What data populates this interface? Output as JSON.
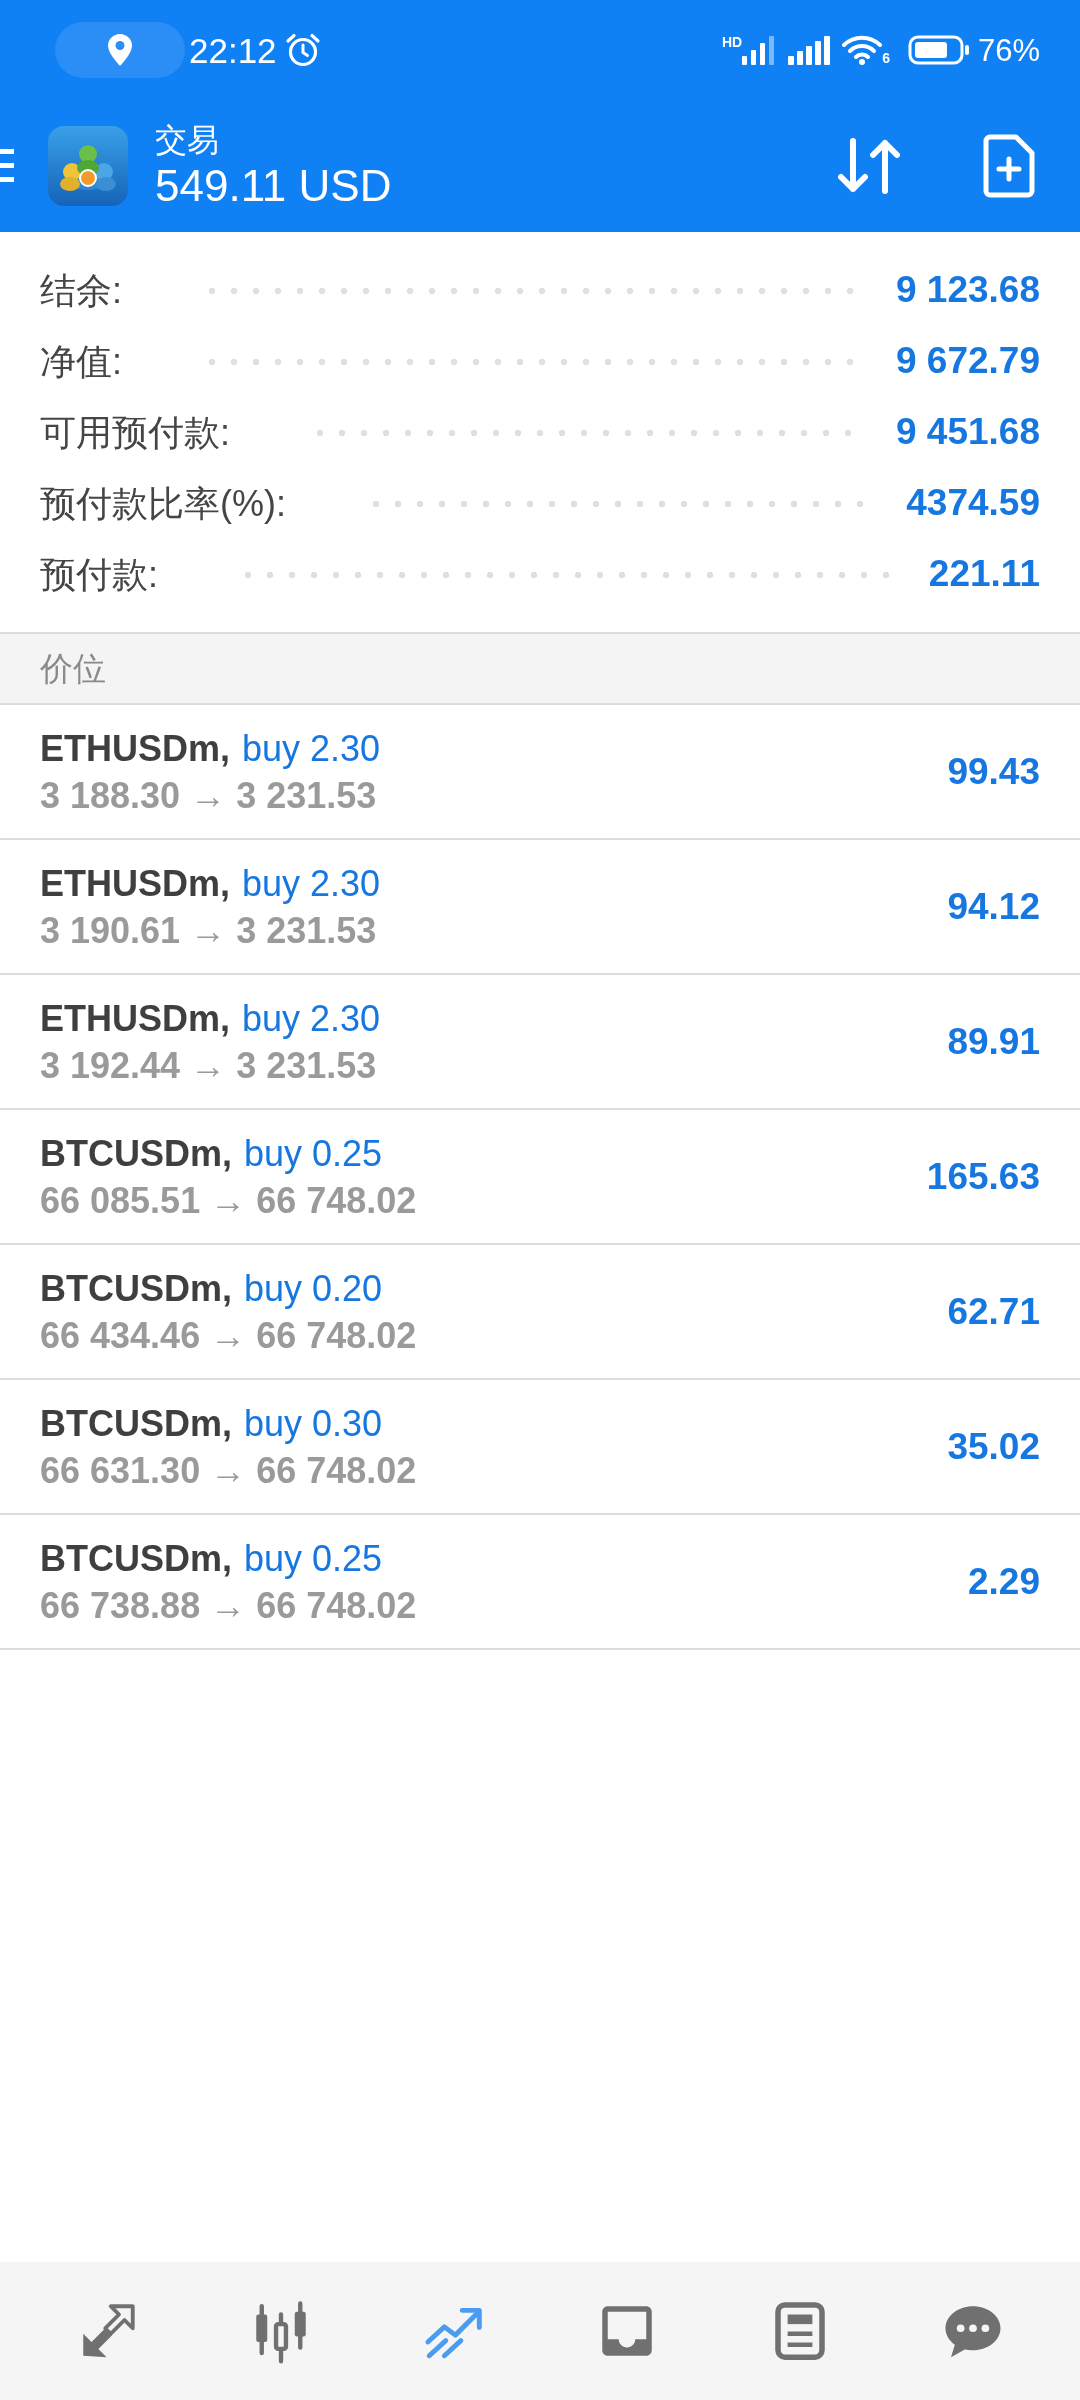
{
  "status_bar": {
    "time": "22:12",
    "network_label": "HD",
    "wifi_label": "6",
    "battery": "76%"
  },
  "header": {
    "title": "交易",
    "balance": "549.11 USD"
  },
  "summary": [
    {
      "label": "结余:",
      "value": "9 123.68"
    },
    {
      "label": "净值:",
      "value": "9 672.79"
    },
    {
      "label": "可用预付款:",
      "value": "9 451.68"
    },
    {
      "label": "预付款比率(%):",
      "value": "4374.59"
    },
    {
      "label": "预付款:",
      "value": "221.11"
    }
  ],
  "section": {
    "title": "价位"
  },
  "positions": [
    {
      "symbol": "ETHUSDm,",
      "order": "buy 2.30",
      "prices": "3 188.30 → 3 231.53",
      "profit": "99.43"
    },
    {
      "symbol": "ETHUSDm,",
      "order": "buy 2.30",
      "prices": "3 190.61 → 3 231.53",
      "profit": "94.12"
    },
    {
      "symbol": "ETHUSDm,",
      "order": "buy 2.30",
      "prices": "3 192.44 → 3 231.53",
      "profit": "89.91"
    },
    {
      "symbol": "BTCUSDm,",
      "order": "buy 0.25",
      "prices": "66 085.51 → 66 748.02",
      "profit": "165.63"
    },
    {
      "symbol": "BTCUSDm,",
      "order": "buy 0.20",
      "prices": "66 434.46 → 66 748.02",
      "profit": "62.71"
    },
    {
      "symbol": "BTCUSDm,",
      "order": "buy 0.30",
      "prices": "66 631.30 → 66 748.02",
      "profit": "35.02"
    },
    {
      "symbol": "BTCUSDm,",
      "order": "buy 0.25",
      "prices": "66 738.88 → 66 748.02",
      "profit": "2.29"
    }
  ],
  "bottom_nav": [
    {
      "kind": "quotes",
      "selected": false
    },
    {
      "kind": "chart",
      "selected": false
    },
    {
      "kind": "trade",
      "selected": true
    },
    {
      "kind": "history",
      "selected": false
    },
    {
      "kind": "news",
      "selected": false
    },
    {
      "kind": "chat",
      "selected": false
    }
  ]
}
